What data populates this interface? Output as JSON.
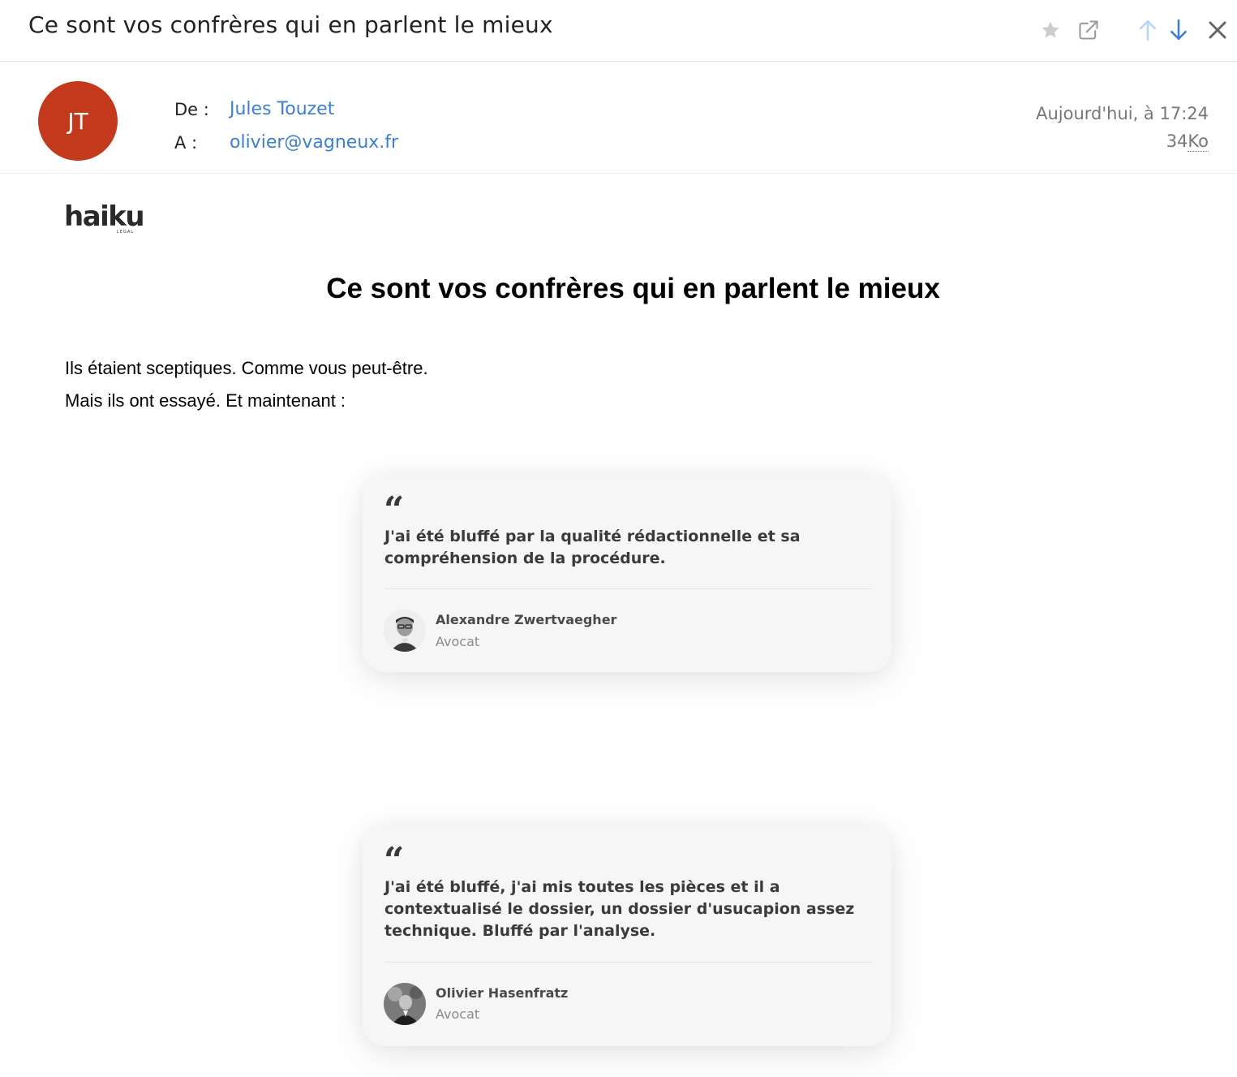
{
  "toolbar": {
    "subject": "Ce sont vos confrères qui en parlent le mieux",
    "icons": [
      "star-icon",
      "open-external-icon",
      "arrow-up-icon",
      "arrow-down-icon",
      "close-icon"
    ],
    "colors": {
      "arrow_up": "#b9d4f5",
      "arrow_down": "#3c7fd0",
      "close": "#666666",
      "star": "#cccccc"
    }
  },
  "header": {
    "avatar_initials": "JT",
    "avatar_color": "#c2391b",
    "from_label": "De :",
    "from_value": "Jules Touzet",
    "to_label": "A :",
    "to_value": "olivier@vagneux.fr",
    "date": "Aujourd'hui, à 17:24",
    "size_number": "34",
    "size_unit": "Ko"
  },
  "body": {
    "logo_text": "haiku",
    "logo_subtext": "LEGAL",
    "title": "Ce sont vos confrères qui en parlent le mieux",
    "intro_line1": "Ils étaient sceptiques. Comme vous peut-être.",
    "intro_line2": "Mais ils ont essayé. Et maintenant :",
    "testimonials": [
      {
        "quote_mark": "“",
        "quote": "J'ai été bluffé par la qualité rédactionnelle et sa compréhension de la procédure.",
        "name": "Alexandre Zwertvaegher",
        "role": "Avocat"
      },
      {
        "quote_mark": "“",
        "quote": "J'ai été bluffé, j'ai mis toutes les pièces et il a contextualisé le dossier, un dossier d'usucapion assez technique. Bluffé par l'analyse.",
        "name": "Olivier Hasenfratz",
        "role": "Avocat"
      }
    ]
  }
}
